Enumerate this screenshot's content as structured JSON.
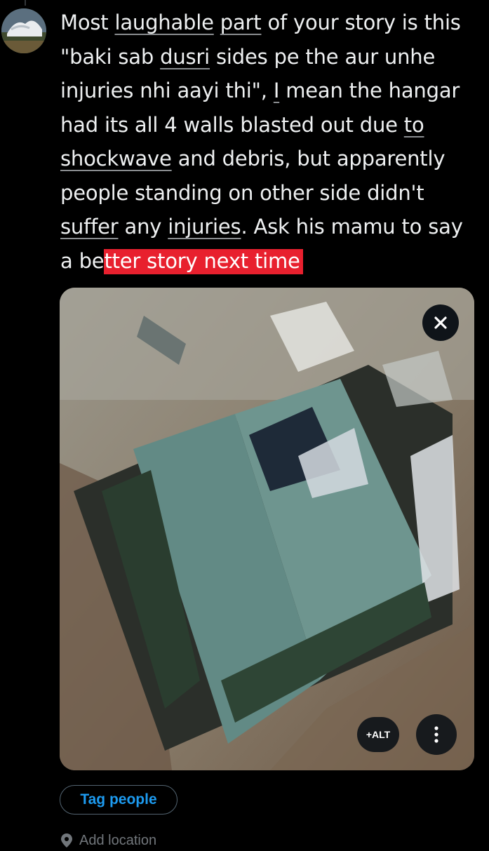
{
  "tweet": {
    "segments": [
      {
        "text": "Most ",
        "style": "plain"
      },
      {
        "text": "laughable",
        "style": "underline"
      },
      {
        "text": " ",
        "style": "plain"
      },
      {
        "text": "part",
        "style": "underline"
      },
      {
        "text": " of your story is this \"baki sab ",
        "style": "plain"
      },
      {
        "text": "dusri",
        "style": "underline"
      },
      {
        "text": " sides pe the aur unhe injuries nhi aayi thi\", ",
        "style": "plain"
      },
      {
        "text": "I",
        "style": "underline"
      },
      {
        "text": " mean the hangar had its all 4 walls blasted out due ",
        "style": "plain"
      },
      {
        "text": "to",
        "style": "underline"
      },
      {
        "text": " ",
        "style": "plain"
      },
      {
        "text": "shockwave",
        "style": "underline"
      },
      {
        "text": " and debris, but apparently people standing on other side didn't ",
        "style": "plain"
      },
      {
        "text": "suffer",
        "style": "underline"
      },
      {
        "text": " any ",
        "style": "plain"
      },
      {
        "text": "injuries",
        "style": "underline"
      },
      {
        "text": ". Ask his mamu to say a be",
        "style": "plain"
      },
      {
        "text": "tter story next time",
        "style": "highlight"
      }
    ]
  },
  "media": {
    "close_icon": "close-icon",
    "alt_label": "+ALT",
    "more_icon": "more-vertical-icon"
  },
  "actions": {
    "tag_people_label": "Tag people",
    "add_location_label": "Add location",
    "location_icon": "location-pin-icon"
  },
  "colors": {
    "background": "#000000",
    "text": "#e7e9ea",
    "accent": "#1d9bf0",
    "highlight": "#e8202e",
    "muted": "#71767b"
  }
}
